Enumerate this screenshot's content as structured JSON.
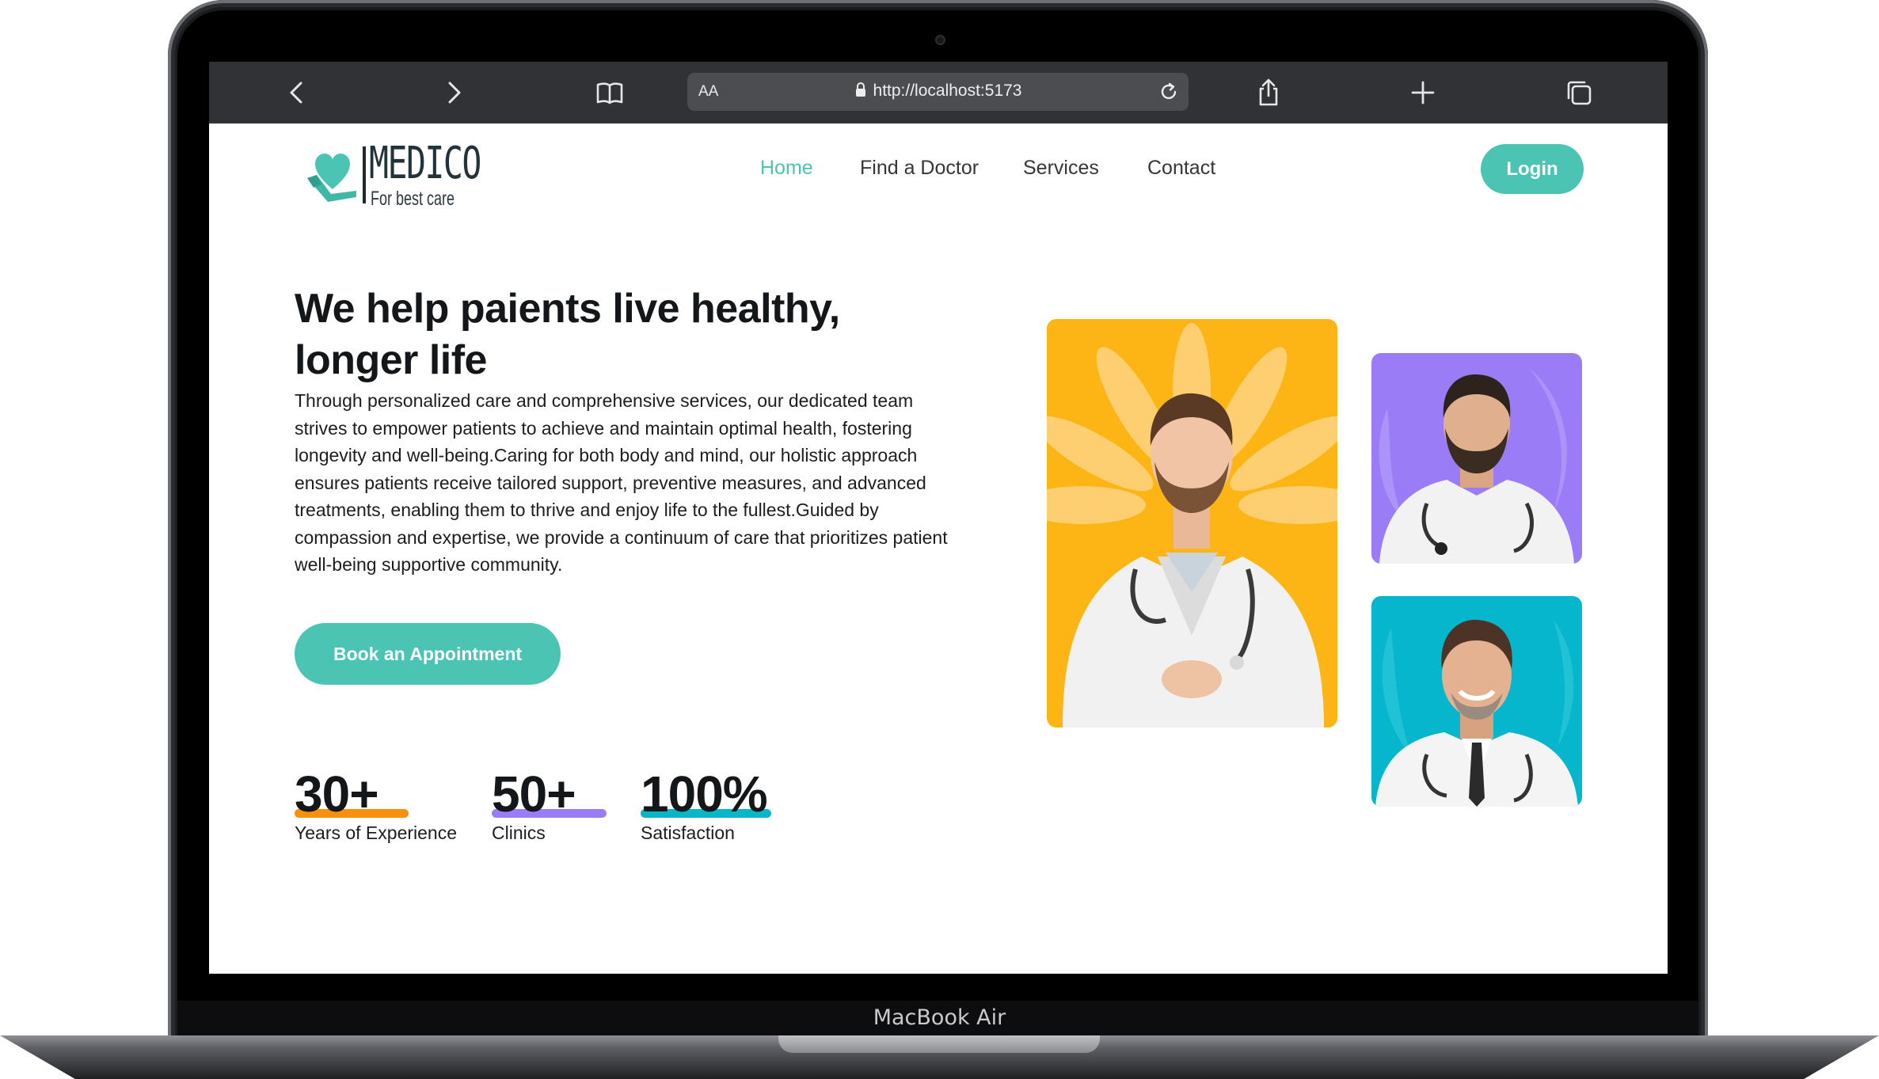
{
  "device": {
    "label": "MacBook Air"
  },
  "browser": {
    "text_size_label": "AA",
    "url": "http://localhost:5173",
    "icons": [
      "back-icon",
      "forward-icon",
      "bookmarks-icon",
      "lock-icon",
      "reload-icon",
      "share-icon",
      "new-tab-icon",
      "tabs-icon"
    ]
  },
  "logo": {
    "name": "MEDICO",
    "tagline": "For best care",
    "icon": "heart-in-hand-icon",
    "color": "#4bc4b3"
  },
  "nav": {
    "items": [
      {
        "label": "Home",
        "active": true
      },
      {
        "label": "Find a Doctor",
        "active": false
      },
      {
        "label": "Services",
        "active": false
      },
      {
        "label": "Contact",
        "active": false
      }
    ],
    "login_label": "Login"
  },
  "hero": {
    "title_line1": "We help paients live healthy,",
    "title_line2": "longer life",
    "body": "Through personalized care and comprehensive services, our dedicated team strives to empower patients to achieve and maintain optimal health, fostering longevity and well-being.Caring for both body and mind, our holistic approach ensures patients receive tailored support, preventive measures, and advanced treatments, enabling them to thrive and enjoy life to the fullest.Guided by compassion and expertise, we provide a continuum of care that prioritizes patient well-being supportive community.",
    "cta_label": "Book an Appointment"
  },
  "stats": [
    {
      "value": "30+",
      "label": "Years of Experience",
      "accent": "#f7900e"
    },
    {
      "value": "50+",
      "label": "Clinics",
      "accent": "#9a7cf5"
    },
    {
      "value": "100%",
      "label": "Satisfaction",
      "accent": "#07b7c8"
    }
  ],
  "doctors": [
    {
      "name": "doctor-photo-large",
      "background": "#fdb515"
    },
    {
      "name": "doctor-photo-bearded",
      "background": "#9b7cf7"
    },
    {
      "name": "doctor-photo-smiling",
      "background": "#05b6cc"
    }
  ],
  "colors": {
    "accent": "#4bc4b3",
    "text": "#14171a",
    "toolbar": "#303235"
  }
}
